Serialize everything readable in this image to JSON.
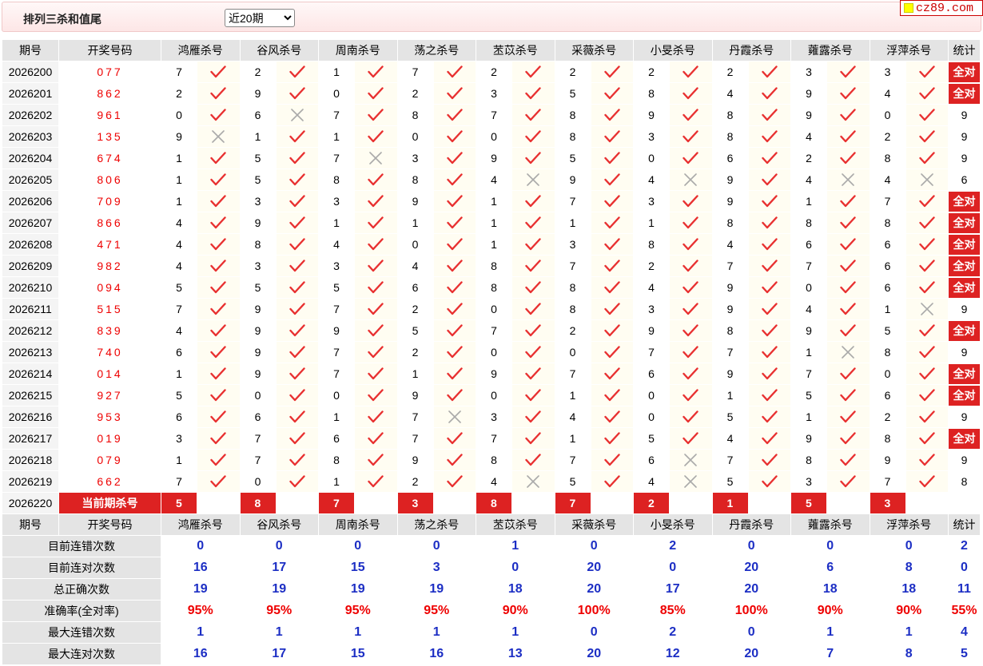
{
  "title": "排列三杀和值尾",
  "period_select": {
    "value": "近20期",
    "options": [
      "近20期"
    ]
  },
  "brand": "cz89.com",
  "colors": {
    "accent": "#d22222",
    "blue": "#1c2ec4",
    "red_text": "#ee0000",
    "check": "#e83030",
    "cross": "#aaaaaa"
  },
  "headers": {
    "issue": "期号",
    "draw": "开奖号码",
    "experts": [
      "鸿雁杀号",
      "谷风杀号",
      "周南杀号",
      "荡之杀号",
      "苤苡杀号",
      "采薇杀号",
      "小旻杀号",
      "丹霞杀号",
      "蕹露杀号",
      "浮萍杀号"
    ],
    "stat": "统计"
  },
  "rows": [
    {
      "issue": "2026200",
      "draw": "077",
      "kills": [
        7,
        2,
        1,
        7,
        2,
        2,
        2,
        2,
        3,
        3
      ],
      "ok": [
        1,
        1,
        1,
        1,
        1,
        1,
        1,
        1,
        1,
        1
      ],
      "stat": "全对"
    },
    {
      "issue": "2026201",
      "draw": "862",
      "kills": [
        2,
        9,
        0,
        2,
        3,
        5,
        8,
        4,
        9,
        4
      ],
      "ok": [
        1,
        1,
        1,
        1,
        1,
        1,
        1,
        1,
        1,
        1
      ],
      "stat": "全对"
    },
    {
      "issue": "2026202",
      "draw": "961",
      "kills": [
        0,
        6,
        7,
        8,
        7,
        8,
        9,
        8,
        9,
        0
      ],
      "ok": [
        1,
        0,
        1,
        1,
        1,
        1,
        1,
        1,
        1,
        1
      ],
      "stat": "9"
    },
    {
      "issue": "2026203",
      "draw": "135",
      "kills": [
        9,
        1,
        1,
        0,
        0,
        8,
        3,
        8,
        4,
        2
      ],
      "ok": [
        0,
        1,
        1,
        1,
        1,
        1,
        1,
        1,
        1,
        1
      ],
      "stat": "9"
    },
    {
      "issue": "2026204",
      "draw": "674",
      "kills": [
        1,
        5,
        7,
        3,
        9,
        5,
        0,
        6,
        2,
        8
      ],
      "ok": [
        1,
        1,
        0,
        1,
        1,
        1,
        1,
        1,
        1,
        1
      ],
      "stat": "9"
    },
    {
      "issue": "2026205",
      "draw": "806",
      "kills": [
        1,
        5,
        8,
        8,
        4,
        9,
        4,
        9,
        4,
        4
      ],
      "ok": [
        1,
        1,
        1,
        1,
        0,
        1,
        0,
        1,
        0,
        0
      ],
      "stat": "6"
    },
    {
      "issue": "2026206",
      "draw": "709",
      "kills": [
        1,
        3,
        3,
        9,
        1,
        7,
        3,
        9,
        1,
        7
      ],
      "ok": [
        1,
        1,
        1,
        1,
        1,
        1,
        1,
        1,
        1,
        1
      ],
      "stat": "全对"
    },
    {
      "issue": "2026207",
      "draw": "866",
      "kills": [
        4,
        9,
        1,
        1,
        1,
        1,
        1,
        8,
        8,
        8
      ],
      "ok": [
        1,
        1,
        1,
        1,
        1,
        1,
        1,
        1,
        1,
        1
      ],
      "stat": "全对"
    },
    {
      "issue": "2026208",
      "draw": "471",
      "kills": [
        4,
        8,
        4,
        0,
        1,
        3,
        8,
        4,
        6,
        6
      ],
      "ok": [
        1,
        1,
        1,
        1,
        1,
        1,
        1,
        1,
        1,
        1
      ],
      "stat": "全对"
    },
    {
      "issue": "2026209",
      "draw": "982",
      "kills": [
        4,
        3,
        3,
        4,
        8,
        7,
        2,
        7,
        7,
        6
      ],
      "ok": [
        1,
        1,
        1,
        1,
        1,
        1,
        1,
        1,
        1,
        1
      ],
      "stat": "全对"
    },
    {
      "issue": "2026210",
      "draw": "094",
      "kills": [
        5,
        5,
        5,
        6,
        8,
        8,
        4,
        9,
        0,
        6
      ],
      "ok": [
        1,
        1,
        1,
        1,
        1,
        1,
        1,
        1,
        1,
        1
      ],
      "stat": "全对"
    },
    {
      "issue": "2026211",
      "draw": "515",
      "kills": [
        7,
        9,
        7,
        2,
        0,
        8,
        3,
        9,
        4,
        1
      ],
      "ok": [
        1,
        1,
        1,
        1,
        1,
        1,
        1,
        1,
        1,
        0
      ],
      "stat": "9"
    },
    {
      "issue": "2026212",
      "draw": "839",
      "kills": [
        4,
        9,
        9,
        5,
        7,
        2,
        9,
        8,
        9,
        5
      ],
      "ok": [
        1,
        1,
        1,
        1,
        1,
        1,
        1,
        1,
        1,
        1
      ],
      "stat": "全对"
    },
    {
      "issue": "2026213",
      "draw": "740",
      "kills": [
        6,
        9,
        7,
        2,
        0,
        0,
        7,
        7,
        1,
        8
      ],
      "ok": [
        1,
        1,
        1,
        1,
        1,
        1,
        1,
        1,
        0,
        1
      ],
      "stat": "9"
    },
    {
      "issue": "2026214",
      "draw": "014",
      "kills": [
        1,
        9,
        7,
        1,
        9,
        7,
        6,
        9,
        7,
        0
      ],
      "ok": [
        1,
        1,
        1,
        1,
        1,
        1,
        1,
        1,
        1,
        1
      ],
      "stat": "全对"
    },
    {
      "issue": "2026215",
      "draw": "927",
      "kills": [
        5,
        0,
        0,
        9,
        0,
        1,
        0,
        1,
        5,
        6
      ],
      "ok": [
        1,
        1,
        1,
        1,
        1,
        1,
        1,
        1,
        1,
        1
      ],
      "stat": "全对"
    },
    {
      "issue": "2026216",
      "draw": "953",
      "kills": [
        6,
        6,
        1,
        7,
        3,
        4,
        0,
        5,
        1,
        2
      ],
      "ok": [
        1,
        1,
        1,
        0,
        1,
        1,
        1,
        1,
        1,
        1
      ],
      "stat": "9"
    },
    {
      "issue": "2026217",
      "draw": "019",
      "kills": [
        3,
        7,
        6,
        7,
        7,
        1,
        5,
        4,
        9,
        8
      ],
      "ok": [
        1,
        1,
        1,
        1,
        1,
        1,
        1,
        1,
        1,
        1
      ],
      "stat": "全对"
    },
    {
      "issue": "2026218",
      "draw": "079",
      "kills": [
        1,
        7,
        8,
        9,
        8,
        7,
        6,
        7,
        8,
        9
      ],
      "ok": [
        1,
        1,
        1,
        1,
        1,
        1,
        0,
        1,
        1,
        1
      ],
      "stat": "9"
    },
    {
      "issue": "2026219",
      "draw": "662",
      "kills": [
        7,
        0,
        1,
        2,
        4,
        5,
        4,
        5,
        3,
        7
      ],
      "ok": [
        1,
        1,
        1,
        1,
        0,
        1,
        0,
        1,
        1,
        1
      ],
      "stat": "8"
    }
  ],
  "current": {
    "issue": "2026220",
    "label": "当前期杀号",
    "kills": [
      "5",
      "8",
      "7",
      "3",
      "8",
      "7",
      "2",
      "1",
      "5",
      "3"
    ]
  },
  "summary": [
    {
      "label": "目前连错次数",
      "values": [
        "0",
        "0",
        "0",
        "0",
        "1",
        "0",
        "2",
        "0",
        "0",
        "0"
      ],
      "stat": "2",
      "color": "blue"
    },
    {
      "label": "目前连对次数",
      "values": [
        "16",
        "17",
        "15",
        "3",
        "0",
        "20",
        "0",
        "20",
        "6",
        "8"
      ],
      "stat": "0",
      "color": "blue"
    },
    {
      "label": "总正确次数",
      "values": [
        "19",
        "19",
        "19",
        "19",
        "18",
        "20",
        "17",
        "20",
        "18",
        "18"
      ],
      "stat": "11",
      "color": "blue"
    },
    {
      "label": "准确率(全对率)",
      "values": [
        "95%",
        "95%",
        "95%",
        "95%",
        "90%",
        "100%",
        "85%",
        "100%",
        "90%",
        "90%"
      ],
      "stat": "55%",
      "color": "red"
    },
    {
      "label": "最大连错次数",
      "values": [
        "1",
        "1",
        "1",
        "1",
        "1",
        "0",
        "2",
        "0",
        "1",
        "1"
      ],
      "stat": "4",
      "color": "blue"
    },
    {
      "label": "最大连对次数",
      "values": [
        "16",
        "17",
        "15",
        "16",
        "13",
        "20",
        "12",
        "20",
        "7",
        "8"
      ],
      "stat": "5",
      "color": "blue"
    }
  ]
}
